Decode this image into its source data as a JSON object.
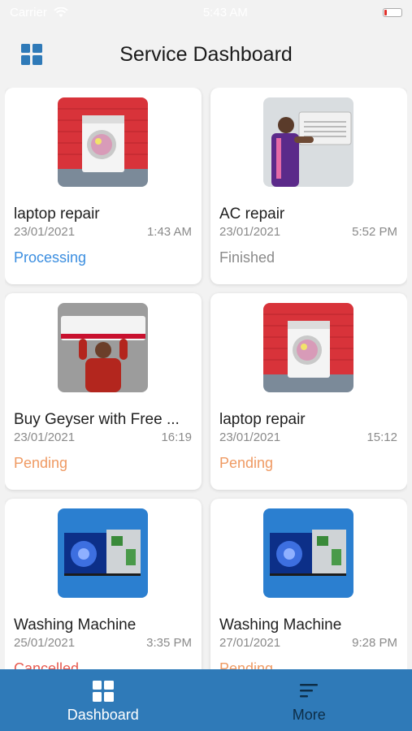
{
  "status_bar": {
    "carrier": "Carrier",
    "time": "5:43 AM"
  },
  "header": {
    "title": "Service Dashboard",
    "menu_icon": "grid-icon"
  },
  "colors": {
    "accent": "#2f7ab8",
    "processing": "#3b8ee0",
    "finished": "#8a8a8a",
    "pending": "#ef9a63",
    "cancelled": "#e85a4f"
  },
  "cards": [
    {
      "name": "laptop repair",
      "date": "23/01/2021",
      "time": "1:43 AM",
      "status": "Processing",
      "image": "washing-machine-image"
    },
    {
      "name": "AC repair",
      "date": "23/01/2021",
      "time": "5:52 PM",
      "status": "Finished",
      "image": "ac-technician-image"
    },
    {
      "name": "Buy Geyser with Free ...",
      "date": "23/01/2021",
      "time": "16:19",
      "status": "Pending",
      "image": "ac-install-image"
    },
    {
      "name": "laptop repair",
      "date": "23/01/2021",
      "time": "15:12",
      "status": "Pending",
      "image": "washing-machine-image"
    },
    {
      "name": "Washing Machine",
      "date": "25/01/2021",
      "time": "3:35 PM",
      "status": "Cancelled",
      "image": "tv-repair-image"
    },
    {
      "name": "Washing Machine",
      "date": "27/01/2021",
      "time": "9:28 PM",
      "status": "Pending",
      "image": "tv-repair-image"
    }
  ],
  "bottom_nav": {
    "items": [
      {
        "label": "Dashboard",
        "icon": "dashboard-icon",
        "active": true
      },
      {
        "label": "More",
        "icon": "filter-lines-icon",
        "active": false
      }
    ]
  }
}
